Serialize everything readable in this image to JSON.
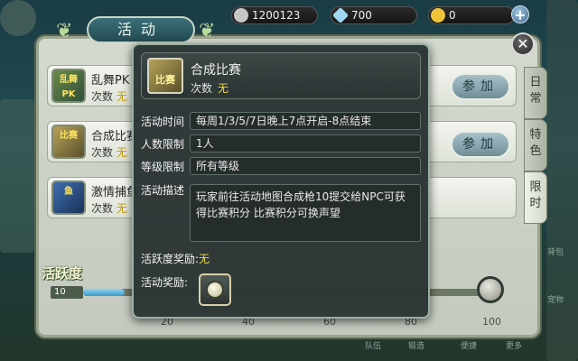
{
  "resources": [
    {
      "icon": "coin-icon",
      "value": "1200123",
      "color": "#c7c7c7"
    },
    {
      "icon": "crystal-icon",
      "value": "700",
      "color": "#9fd6f0"
    },
    {
      "icon": "gold-icon",
      "value": "0",
      "color": "#f0c23a"
    }
  ],
  "window": {
    "title": "活动",
    "side_tabs": [
      {
        "label": "日常",
        "active": false
      },
      {
        "label": "特色",
        "active": false
      },
      {
        "label": "限时",
        "active": true
      }
    ]
  },
  "activities": [
    {
      "name": "乱舞PK",
      "icon_text": "乱舞PK",
      "count_label": "次数",
      "count_value": "无",
      "join_label": "参加"
    },
    {
      "name": "合成比赛",
      "icon_text": "比赛",
      "count_label": "次数",
      "count_value": "无",
      "join_label": "参加"
    },
    {
      "name": "激情捕鱼",
      "icon_text": "鱼",
      "count_label": "次数",
      "count_value": "无",
      "join_label": ""
    }
  ],
  "activity_bar": {
    "label": "活跃度",
    "current": "10",
    "progress": 0.1,
    "ticks": [
      "20",
      "40",
      "60",
      "80",
      "100"
    ]
  },
  "popup": {
    "title": "合成比赛",
    "icon_text": "比赛",
    "count_label": "次数",
    "count_value": "无",
    "fields": {
      "time_label": "活动时间",
      "time_value": "每周1/3/5/7日晚上7点开启-8点结束",
      "people_label": "人数限制",
      "people_value": "1人",
      "level_label": "等级限制",
      "level_value": "所有等级",
      "desc_label": "活动描述",
      "desc_value": "玩家前往活动地图合成枪10提交给NPC可获得比赛积分 比赛积分可换声望"
    },
    "activity_reward_label": "活跃度奖励:",
    "activity_reward_value": "无",
    "reward_label": "活动奖励:"
  },
  "background": {
    "bottom_menu": [
      "队伍",
      "锻造",
      "便捷",
      "更多"
    ],
    "right_menu": [
      "背包",
      "宠物"
    ]
  }
}
